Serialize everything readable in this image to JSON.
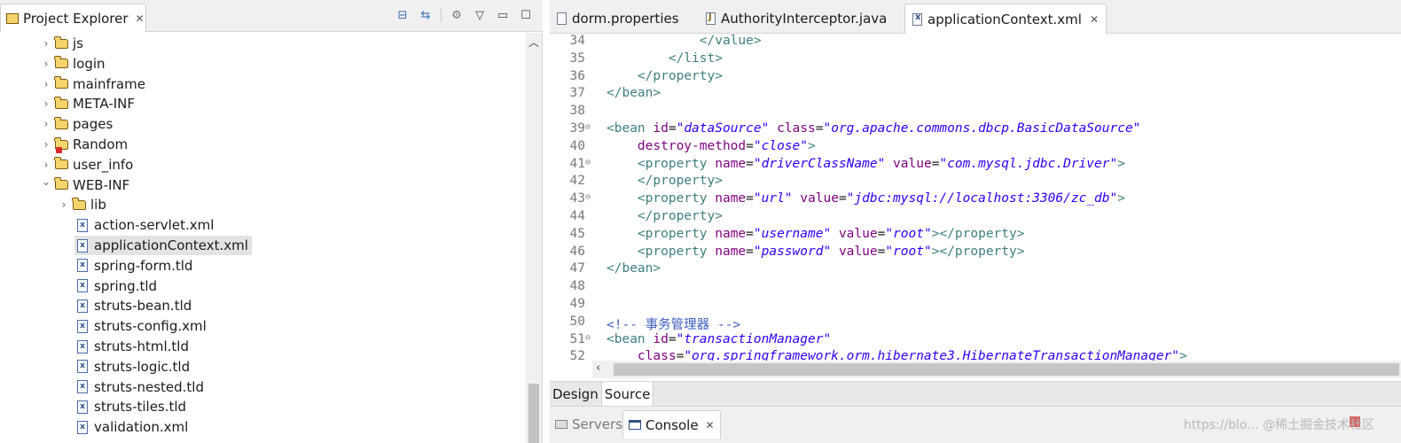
{
  "explorer": {
    "title": "Project Explorer",
    "items": [
      {
        "label": "js",
        "type": "folder",
        "expanded": false
      },
      {
        "label": "login",
        "type": "folder",
        "expanded": false
      },
      {
        "label": "mainframe",
        "type": "folder",
        "expanded": false
      },
      {
        "label": "META-INF",
        "type": "folder",
        "expanded": false
      },
      {
        "label": "pages",
        "type": "folder",
        "expanded": false
      },
      {
        "label": "Random",
        "type": "folder",
        "expanded": false,
        "error": true
      },
      {
        "label": "user_info",
        "type": "folder",
        "expanded": false
      },
      {
        "label": "WEB-INF",
        "type": "folder",
        "expanded": true
      },
      {
        "label": "lib",
        "type": "folder",
        "expanded": false
      },
      {
        "label": "action-servlet.xml",
        "type": "file"
      },
      {
        "label": "applicationContext.xml",
        "type": "file",
        "selected": true
      },
      {
        "label": "spring-form.tld",
        "type": "file"
      },
      {
        "label": "spring.tld",
        "type": "file"
      },
      {
        "label": "struts-bean.tld",
        "type": "file"
      },
      {
        "label": "struts-config.xml",
        "type": "file"
      },
      {
        "label": "struts-html.tld",
        "type": "file"
      },
      {
        "label": "struts-logic.tld",
        "type": "file"
      },
      {
        "label": "struts-nested.tld",
        "type": "file"
      },
      {
        "label": "struts-tiles.tld",
        "type": "file"
      },
      {
        "label": "validation.xml",
        "type": "file"
      }
    ]
  },
  "editor": {
    "tabs": [
      {
        "label": "dorm.properties",
        "icon": "properties-file-icon",
        "active": false
      },
      {
        "label": "AuthorityInterceptor.java",
        "icon": "java-file-icon",
        "active": false
      },
      {
        "label": "applicationContext.xml",
        "icon": "xml-file-icon",
        "active": true
      }
    ],
    "lines": [
      {
        "n": "34",
        "fold": false,
        "tokens": [
          [
            "txt",
            "            "
          ],
          [
            "tag",
            "</value>"
          ]
        ]
      },
      {
        "n": "35",
        "fold": false,
        "tokens": [
          [
            "txt",
            "        "
          ],
          [
            "tag",
            "</list>"
          ]
        ]
      },
      {
        "n": "36",
        "fold": false,
        "tokens": [
          [
            "txt",
            "    "
          ],
          [
            "tag",
            "</property>"
          ]
        ]
      },
      {
        "n": "37",
        "fold": false,
        "tokens": [
          [
            "tag",
            "</bean>"
          ]
        ]
      },
      {
        "n": "38",
        "fold": false,
        "tokens": []
      },
      {
        "n": "39",
        "fold": true,
        "tokens": [
          [
            "tag",
            "<bean "
          ],
          [
            "attr",
            "id"
          ],
          [
            "txt",
            "="
          ],
          [
            "val",
            "\"dataSource\""
          ],
          [
            "txt",
            " "
          ],
          [
            "attr",
            "class"
          ],
          [
            "txt",
            "="
          ],
          [
            "val",
            "\"org.apache.commons.dbcp.BasicDataSource\""
          ]
        ]
      },
      {
        "n": "40",
        "fold": false,
        "tokens": [
          [
            "txt",
            "    "
          ],
          [
            "attr",
            "destroy-method"
          ],
          [
            "txt",
            "="
          ],
          [
            "val",
            "\"close\""
          ],
          [
            "tag",
            ">"
          ]
        ]
      },
      {
        "n": "41",
        "fold": true,
        "tokens": [
          [
            "txt",
            "    "
          ],
          [
            "tag",
            "<property "
          ],
          [
            "attr",
            "name"
          ],
          [
            "txt",
            "="
          ],
          [
            "val",
            "\"driverClassName\""
          ],
          [
            "txt",
            " "
          ],
          [
            "attr",
            "value"
          ],
          [
            "txt",
            "="
          ],
          [
            "val",
            "\"com.mysql.jdbc.Driver\""
          ],
          [
            "tag",
            ">"
          ]
        ]
      },
      {
        "n": "42",
        "fold": false,
        "tokens": [
          [
            "txt",
            "    "
          ],
          [
            "tag",
            "</property>"
          ]
        ]
      },
      {
        "n": "43",
        "fold": true,
        "tokens": [
          [
            "txt",
            "    "
          ],
          [
            "tag",
            "<property "
          ],
          [
            "attr",
            "name"
          ],
          [
            "txt",
            "="
          ],
          [
            "val",
            "\"url\""
          ],
          [
            "txt",
            " "
          ],
          [
            "attr",
            "value"
          ],
          [
            "txt",
            "="
          ],
          [
            "val",
            "\"jdbc:mysql://localhost:3306/zc_db\""
          ],
          [
            "tag",
            ">"
          ]
        ]
      },
      {
        "n": "44",
        "fold": false,
        "tokens": [
          [
            "txt",
            "    "
          ],
          [
            "tag",
            "</property>"
          ]
        ]
      },
      {
        "n": "45",
        "fold": false,
        "tokens": [
          [
            "txt",
            "    "
          ],
          [
            "tag",
            "<property "
          ],
          [
            "attr",
            "name"
          ],
          [
            "txt",
            "="
          ],
          [
            "val",
            "\"username\""
          ],
          [
            "txt",
            " "
          ],
          [
            "attr",
            "value"
          ],
          [
            "txt",
            "="
          ],
          [
            "val",
            "\"root\""
          ],
          [
            "tag",
            "></property>"
          ]
        ]
      },
      {
        "n": "46",
        "fold": false,
        "tokens": [
          [
            "txt",
            "    "
          ],
          [
            "tag",
            "<property "
          ],
          [
            "attr",
            "name"
          ],
          [
            "txt",
            "="
          ],
          [
            "val",
            "\"password\""
          ],
          [
            "txt",
            " "
          ],
          [
            "attr",
            "value"
          ],
          [
            "txt",
            "="
          ],
          [
            "val",
            "\"root\""
          ],
          [
            "tag",
            "></property>"
          ]
        ]
      },
      {
        "n": "47",
        "fold": false,
        "tokens": [
          [
            "tag",
            "</bean>"
          ]
        ]
      },
      {
        "n": "48",
        "fold": false,
        "tokens": []
      },
      {
        "n": "49",
        "fold": false,
        "tokens": []
      },
      {
        "n": "50",
        "fold": false,
        "tokens": [
          [
            "cmt",
            "<!-- 事务管理器 -->"
          ]
        ]
      },
      {
        "n": "51",
        "fold": true,
        "tokens": [
          [
            "tag",
            "<bean "
          ],
          [
            "attr",
            "id"
          ],
          [
            "txt",
            "="
          ],
          [
            "val",
            "\"transactionManager\""
          ]
        ]
      },
      {
        "n": "52",
        "fold": false,
        "tokens": [
          [
            "txt",
            "    "
          ],
          [
            "attr",
            "class"
          ],
          [
            "txt",
            "="
          ],
          [
            "val",
            "\"org.springframework.orm.hibernate3.HibernateTransactionManager\""
          ],
          [
            "tag",
            ">"
          ]
        ]
      }
    ],
    "design_tab": "Design",
    "source_tab": "Source"
  },
  "bottom": {
    "servers_tab": "Servers",
    "console_tab": "Console",
    "watermark": "https://blo... @稀土掘金技术社区"
  }
}
